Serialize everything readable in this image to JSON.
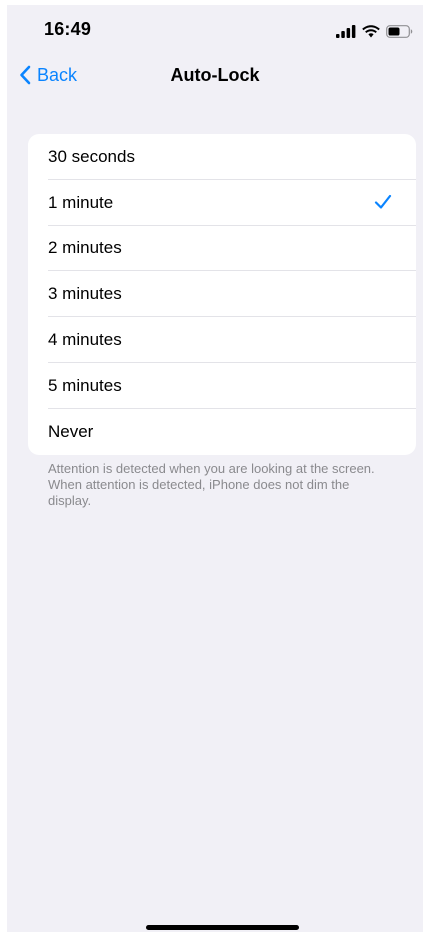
{
  "status_bar": {
    "time": "16:49",
    "icons": [
      "signal-icon",
      "wifi-icon",
      "battery-icon"
    ]
  },
  "nav": {
    "back_label": "Back",
    "title": "Auto-Lock",
    "accent_color": "#0a84ff"
  },
  "options": {
    "items": [
      {
        "label": "30 seconds",
        "selected": false
      },
      {
        "label": "1 minute",
        "selected": true
      },
      {
        "label": "2 minutes",
        "selected": false
      },
      {
        "label": "3 minutes",
        "selected": false
      },
      {
        "label": "4 minutes",
        "selected": false
      },
      {
        "label": "5 minutes",
        "selected": false
      },
      {
        "label": "Never",
        "selected": false
      }
    ],
    "selected_icon": "checkmark-icon"
  },
  "footer": {
    "note": "Attention is detected when you are looking at the screen. When attention is detected, iPhone does not dim the display."
  }
}
